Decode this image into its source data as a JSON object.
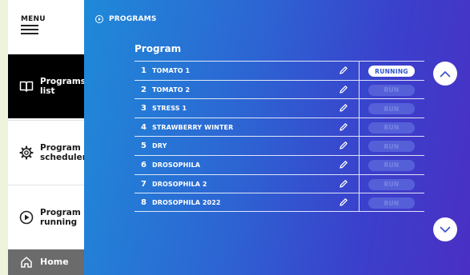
{
  "menu": {
    "label": "MENU",
    "icon": "hamburger-icon"
  },
  "sidebar": {
    "items": [
      {
        "label": "Programs list",
        "icon": "book-icon",
        "active": true
      },
      {
        "label": "Program scheduler",
        "icon": "gear-icon",
        "active": false
      },
      {
        "label": "Program running",
        "icon": "play-circle-icon",
        "active": false
      },
      {
        "label": "Home",
        "icon": "home-icon",
        "active": false
      }
    ]
  },
  "breadcrumb": {
    "label": "PROGRAMS",
    "icon": "play-circle-icon"
  },
  "main": {
    "heading": "Program",
    "rows": [
      {
        "number": "1",
        "name": "TOMATO 1",
        "status": "RUNNING"
      },
      {
        "number": "2",
        "name": "TOMATO 2",
        "status": "RUN"
      },
      {
        "number": "3",
        "name": "STRESS 1",
        "status": "RUN"
      },
      {
        "number": "4",
        "name": "STRAWBERRY WINTER",
        "status": "RUN"
      },
      {
        "number": "5",
        "name": "DRY",
        "status": "RUN"
      },
      {
        "number": "6",
        "name": "DROSOPHILA",
        "status": "RUN"
      },
      {
        "number": "7",
        "name": "DROSOPHILA 2",
        "status": "RUN"
      },
      {
        "number": "8",
        "name": "DROSOPHILA 2022",
        "status": "RUN"
      }
    ]
  },
  "colors": {
    "page_background": "#eef3de",
    "gradient_start": "#1f8ad8",
    "gradient_end": "#4a2fc4",
    "active_nav": "#000000",
    "home_nav": "#6b6b6b",
    "status_running_bg": "#ffffff",
    "status_run_bg": "#5560d8"
  }
}
